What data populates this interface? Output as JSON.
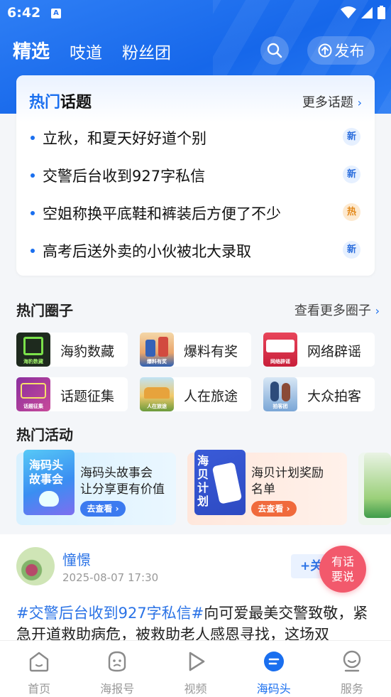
{
  "status_bar": {
    "time": "6:42",
    "app_icon": "A"
  },
  "tabs": [
    {
      "label": "精选",
      "active": true
    },
    {
      "label": "吱道",
      "active": false
    },
    {
      "label": "粉丝团",
      "active": false
    }
  ],
  "publish_label": "发布",
  "hot_topics": {
    "title_highlight": "热门",
    "title_rest": "话题",
    "more": "更多话题",
    "items": [
      {
        "text": "立秋，和夏天好好道个别",
        "badge": "新",
        "type": "new"
      },
      {
        "text": "交警后台收到927字私信",
        "badge": "新",
        "type": "new"
      },
      {
        "text": "空姐称换平底鞋和裤装后方便了不少",
        "badge": "热",
        "type": "hot"
      },
      {
        "text": "高考后送外卖的小伙被北大录取",
        "badge": "新",
        "type": "new"
      }
    ]
  },
  "hot_circles": {
    "title": "热门圈子",
    "more": "查看更多圈子",
    "items": [
      {
        "name": "海豹数藏",
        "cap": "海豹数藏"
      },
      {
        "name": "爆料有奖",
        "cap": "爆料有奖"
      },
      {
        "name": "网络辟谣",
        "cap": "网络辟谣"
      },
      {
        "name": "话题征集",
        "cap": "话题征集"
      },
      {
        "name": "人在旅途",
        "cap": "人在旅途"
      },
      {
        "name": "大众拍客",
        "cap": "拍客团"
      }
    ]
  },
  "hot_activities": {
    "title": "热门活动",
    "items": [
      {
        "art_text": "海码头故事会",
        "line1": "海码头故事会",
        "line2": "让分享更有价值",
        "button": "去查看"
      },
      {
        "art_text": "海贝计划",
        "line1": "海贝计划奖励",
        "line2": "名单",
        "button": "去查看"
      }
    ]
  },
  "post": {
    "username": "憧憬",
    "time": "2025-08-07 17:30",
    "follow": "+关",
    "tag": "#交警后台收到927字私信#",
    "text": "向可爱最美交警致敬，紧急开道救助病危，被救助老人感恩寻找，这场双"
  },
  "float_button": {
    "line1": "有话",
    "line2": "要说"
  },
  "bottom_nav": [
    {
      "label": "首页",
      "active": false
    },
    {
      "label": "海报号",
      "active": false
    },
    {
      "label": "视频",
      "active": false
    },
    {
      "label": "海码头",
      "active": true
    },
    {
      "label": "服务",
      "active": false
    }
  ],
  "colors": {
    "brand": "#1a6fef",
    "hot": "#e38a1c",
    "float": "#f2596c"
  }
}
